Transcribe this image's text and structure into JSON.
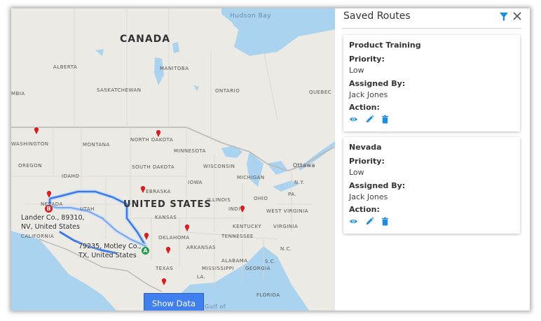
{
  "map": {
    "labels": {
      "hudson_bay": "Hudson Bay",
      "canada": "CANADA",
      "alberta": "ALBERTA",
      "manitoba": "MANITOBA",
      "saskatchewan": "SASKATCHEWAN",
      "ontario": "ONTARIO",
      "quebec": "QUEBEC",
      "mbia": "MBIA",
      "washington": "WASHINGTON",
      "montana": "MONTANA",
      "north_dakota": "NORTH DAKOTA",
      "minnesota": "MINNESOTA",
      "oregon": "OREGON",
      "idaho": "IDAHO",
      "south_dakota": "SOUTH DAKOTA",
      "wisconsin": "WISCONSIN",
      "ottawa": "Ottawa",
      "iowa": "IOWA",
      "michigan": "MICHIGAN",
      "ny": "N.Y.",
      "nebraska": "EBRASKA",
      "pa": "PA.",
      "nevada": "NEVADA",
      "utah": "UTAH",
      "united_states": "UNITED STATES",
      "illinois": "ILLINOIS",
      "indiana": "INDIA",
      "ohio": "OHIO",
      "kansas": "KANSAS",
      "west_virginia": "WEST VIRGINIA",
      "kentucky": "KENTUCKY",
      "virginia": "VIRGINIA",
      "california": "CALIFORNIA",
      "oklahoma": "OKLAHOMA",
      "tennessee": "TENNESSEE",
      "arkansas": "ARKANSAS",
      "nc": "N.C.",
      "sc": "S.C.",
      "texas": "TEXAS",
      "mississippi": "MISSISSIPPI",
      "alabama": "ALABAMA",
      "georgia": "GEORGIA",
      "la": "LA.",
      "florida": "FLORIDA",
      "gulf": "Gulf of"
    },
    "start_marker": "A",
    "end_marker": "B",
    "origin_address": "79235, Motley Co.,\nTX, United States",
    "destination_address": "Lander Co., 89310,\nNV, United States",
    "show_data_label": "Show Data"
  },
  "panel": {
    "title": "Saved Routes",
    "filter_icon": "filter-icon",
    "close_icon": "close-icon",
    "routes": [
      {
        "name": "Product Training",
        "priority_label": "Priority:",
        "priority": "Low",
        "assigned_label": "Assigned By:",
        "assigned_by": "Jack Jones",
        "action_label": "Action:",
        "actions": [
          "eye-icon",
          "pencil-icon",
          "trash-icon"
        ]
      },
      {
        "name": "Nevada",
        "priority_label": "Priority:",
        "priority": "Low",
        "assigned_label": "Assigned By:",
        "assigned_by": "Jack Jones",
        "action_label": "Action:",
        "actions": [
          "eye-icon",
          "pencil-icon",
          "trash-icon"
        ]
      }
    ]
  },
  "colors": {
    "accent": "#1b8de0",
    "pin": "#e11a1a",
    "route": "#3b7ae6",
    "show_data": "#3f7ff0"
  }
}
